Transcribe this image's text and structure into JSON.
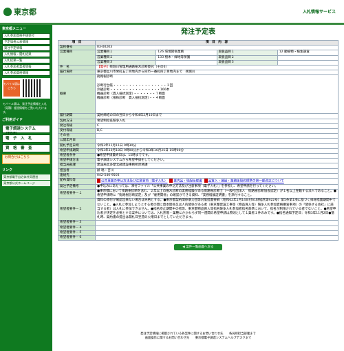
{
  "header": {
    "logo": "東京都",
    "service": "入札情報サービス"
  },
  "sidebar": {
    "section_menu": "東京都メニュー",
    "menu": [
      "入札参加資格申請受付",
      "予定価格公表情報",
      "発注予定情報",
      "入札情報・開札結果",
      "入札結果一覧",
      "入札参加者業者情報",
      "入札参加資格情報"
    ],
    "mobile_label": "モバイル版はこちら",
    "mobile_note": "モバイル版は、発注予定情報と入札（見積）経過情報をご覧いただけます。",
    "section_guide": "ご利用ガイド",
    "guide_items": [
      "電子調達システム(TOP)",
      "電　子　入　札",
      "資　格　審　査"
    ],
    "contact": "お問合せはこちら",
    "section_links": "リンク",
    "links": [
      "東京都電子自治体共同運営",
      "東京都公式ホームページ"
    ]
  },
  "page": {
    "title": "発注予定表",
    "col_item": "項　目",
    "col_content": "項　目　内　容",
    "contract_no_label": "契約番号",
    "contract_no": "03-00203",
    "biz_label": "営業種目",
    "biz1": {
      "k1": "営業種目１",
      "v1": "126 環境関係業務",
      "k2": "取扱品目１",
      "v2": "12 動植物・植生調査"
    },
    "biz2": {
      "k1": "営業種目２",
      "v1": "133 樹木・緑地等保護",
      "k2": "取扱品目２",
      "v2": ""
    },
    "biz3": {
      "k1": "営業種目３",
      "v1": "",
      "k2": "取扱品目３",
      "v2": ""
    },
    "name_label": "件　名",
    "name_tag": "【電子】",
    "name": "残堀川管理用通路樹木診断委託（その6）",
    "place_label": "履行場所",
    "place": "東京都立川市栄町五丁目地内から同市一番町四丁目地内まで　残堀川",
    "summary_label": "概要",
    "summary": [
      "街路樹診断",
      "",
      "診断行台帳・・・・・・・・・・・・・・・・・３回",
      "外観診断・・・・・・・・・・・・・・・・166本",
      "機器診断（貫入抵抗測定）・・・・・・・７断面",
      "機器診断（根株診断　貫入抵抗測定）・・４断面"
    ],
    "period_label": "履行期間",
    "period": "契約締結の日の翌日から令和4年2月10日まで",
    "method_label": "契約方法",
    "method": "希望制指名競争入札",
    "dept_label": "発注等級",
    "dept": "C",
    "recv_label": "受付等級",
    "recv": "B,C",
    "other_label": "その他",
    "other": "",
    "public_label": "公開年月日",
    "public": "",
    "open_label": "開札予定日時",
    "open": "令和3年11月11日 9時30分",
    "apply_label": "希望申請期間",
    "apply": "令和3年10月18日 9時00分から令和3年10月25日 15時00分",
    "condition_label": "希望者条件",
    "condition": "●希望申請最終日は、15時までです。",
    "method2_label": "希望申請方法",
    "method2": "電子調達システムから希望申請をしてください。",
    "office_label": "担当局部課",
    "office": "建設局北多摩北部建設事務所庶務課",
    "person_label": "担当者",
    "person": "齢 唱・吉川",
    "tel_label": "連絡先",
    "tel": "042-540-9503",
    "docs_label": "配布資料等",
    "docs": [
      "公共事業の申込方法及び注意事項（電子入札）",
      "業内品・現配仕様書",
      "品質入・選設・業務係契約標準の第一部改正について"
    ],
    "prelim_label": "発注予定備考",
    "prelim": "●申込みにあたっては、添付ファイル「公共事業の申込方法及び注意事項（電子入札）」を参照し、希望申請を行ってください。",
    "req1_label": "希望者要件－１",
    "req1": "●東京都において街路樹診断を含む、２年以上の樹木診断の実務経験がある街路樹診断士（一般社団法人　街路樹診断協会認定）が１名以上在籍する法人であること。●希望申請時に「街路樹診断認定」及び「雇用関係」の確認ができる資料、「実務経験証明書」を添付すること。",
    "req2_label": "希望者要件－２",
    "req2": "資料の添付が確認出来ない場合は失格とする。●東京都契約関係暴力団等対策措置要綱（昭和62年1月14日付61財経庶第922号）第5条第1項に基づく排除措置期間中でないこと。●入札に参加しようとする者の間に資本関係又は人的関係がある者（東京都建設工事等（物品買入等）競争入札参加資格審査事項）の「関係する会社」に該当する者）は入札に参加できません。●指名停止期間中の者等、東京都物品買入等指名競争入札参加者指名基準において、指名が制限されている者でないこと。●希望申込者が決定を必要とする案件については、入札形態・業種にかかわらず同一週間の希望申請は原則として１業者１件のみです。●指名通知予定日：令和3年11月2日●落札時、契約書の提出は開札日翌週の火曜日までとしていただきます。",
    "req3_label": "希望者要件－３",
    "req4_label": "希望者要件－４",
    "req5_label": "希望者要件－５",
    "req6_label": "希望者要件－６",
    "back_button": "◀ 案件一覧画面へ戻る"
  },
  "footer": {
    "line1": "発注予定情報に掲載されている各案件に関するお問い合わせ先　　各局所担当部署まで",
    "line2": "画面操作に関するお問い合わせ先　　東京都電子調達システムヘルプデスクまで"
  }
}
